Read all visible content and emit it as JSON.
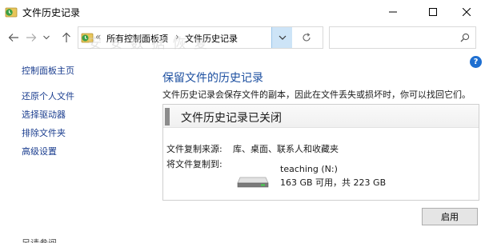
{
  "window": {
    "title": "文件历史记录",
    "icons": {
      "app": "file-history-icon",
      "minimize": "minimize-icon",
      "maximize": "maximize-icon",
      "close": "close-icon"
    }
  },
  "address": {
    "overflow": "«",
    "crumb1": "所有控制面板项",
    "sep": "›",
    "crumb2": "文件历史记录",
    "search_placeholder": ""
  },
  "watermark": "安 安 数 据 恢 复",
  "sidebar": {
    "items": [
      {
        "label": "控制面板主页"
      },
      {
        "label": "还原个人文件"
      },
      {
        "label": "选择驱动器"
      },
      {
        "label": "排除文件夹"
      },
      {
        "label": "高级设置"
      }
    ],
    "bottom_label": "另请参阅"
  },
  "main": {
    "title": "保留文件的历史记录",
    "description": "文件历史记录会保存文件的副本，因此在文件丢失或损坏时，你可以找回它们。",
    "status_title": "文件历史记录已关闭",
    "copy_from_label": "文件复制来源:",
    "copy_from_value": "库、桌面、联系人和收藏夹",
    "copy_to_label": "将文件复制到:",
    "drive_name": "teaching (N:)",
    "drive_space": "163 GB 可用，共 223 GB",
    "apply_label": "启用"
  },
  "colors": {
    "link": "#1a3d8f",
    "title": "#1c4fa0",
    "dropdown_active": "#cde4f7",
    "help": "#1e6fd1"
  }
}
